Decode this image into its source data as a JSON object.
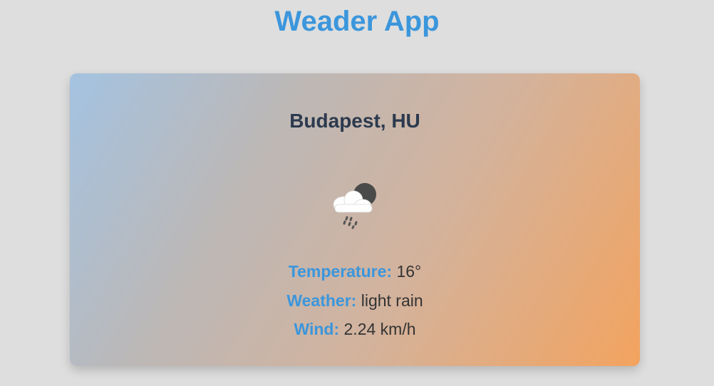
{
  "app": {
    "title": "Weader App"
  },
  "card": {
    "city": "Budapest, HU",
    "icon": "cloud-moon-rain-icon",
    "temperature": {
      "label": "Temperature:",
      "value": "16°"
    },
    "weather": {
      "label": "Weather:",
      "value": "light rain"
    },
    "wind": {
      "label": "Wind:",
      "value": "2.24 km/h"
    }
  },
  "colors": {
    "accent": "#3b96dc",
    "background": "#dedede",
    "city_text": "#2c3a4e",
    "gradient_start": "#a4c3e1",
    "gradient_end": "#f3a35f"
  }
}
